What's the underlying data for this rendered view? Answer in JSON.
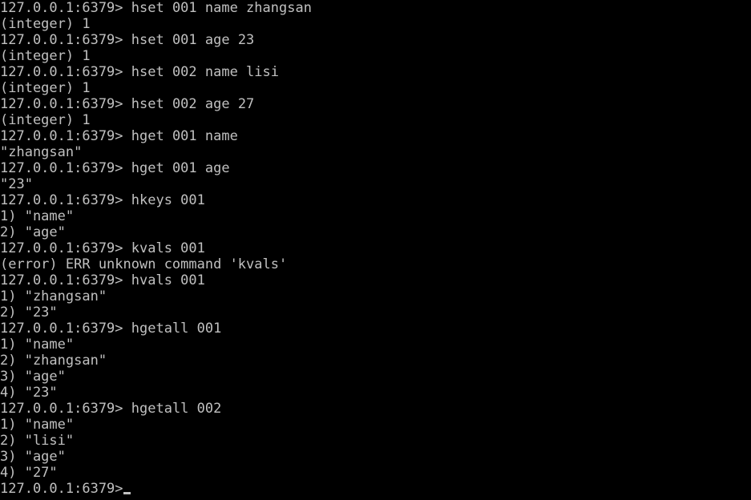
{
  "terminal": {
    "lines": [
      {
        "prompt": "127.0.0.1:6379> ",
        "text": "hset 001 name zhangsan"
      },
      {
        "prompt": "",
        "text": "(integer) 1"
      },
      {
        "prompt": "127.0.0.1:6379> ",
        "text": "hset 001 age 23"
      },
      {
        "prompt": "",
        "text": "(integer) 1"
      },
      {
        "prompt": "127.0.0.1:6379> ",
        "text": "hset 002 name lisi"
      },
      {
        "prompt": "",
        "text": "(integer) 1"
      },
      {
        "prompt": "127.0.0.1:6379> ",
        "text": "hset 002 age 27"
      },
      {
        "prompt": "",
        "text": "(integer) 1"
      },
      {
        "prompt": "127.0.0.1:6379> ",
        "text": "hget 001 name"
      },
      {
        "prompt": "",
        "text": "\"zhangsan\""
      },
      {
        "prompt": "127.0.0.1:6379> ",
        "text": "hget 001 age"
      },
      {
        "prompt": "",
        "text": "\"23\""
      },
      {
        "prompt": "127.0.0.1:6379> ",
        "text": "hkeys 001"
      },
      {
        "prompt": "",
        "text": "1) \"name\""
      },
      {
        "prompt": "",
        "text": "2) \"age\""
      },
      {
        "prompt": "127.0.0.1:6379> ",
        "text": "kvals 001"
      },
      {
        "prompt": "",
        "text": "(error) ERR unknown command 'kvals'"
      },
      {
        "prompt": "127.0.0.1:6379> ",
        "text": "hvals 001"
      },
      {
        "prompt": "",
        "text": "1) \"zhangsan\""
      },
      {
        "prompt": "",
        "text": "2) \"23\""
      },
      {
        "prompt": "127.0.0.1:6379> ",
        "text": "hgetall 001"
      },
      {
        "prompt": "",
        "text": "1) \"name\""
      },
      {
        "prompt": "",
        "text": "2) \"zhangsan\""
      },
      {
        "prompt": "",
        "text": "3) \"age\""
      },
      {
        "prompt": "",
        "text": "4) \"23\""
      },
      {
        "prompt": "127.0.0.1:6379> ",
        "text": "hgetall 002"
      },
      {
        "prompt": "",
        "text": "1) \"name\""
      },
      {
        "prompt": "",
        "text": "2) \"lisi\""
      },
      {
        "prompt": "",
        "text": "3) \"age\""
      },
      {
        "prompt": "",
        "text": "4) \"27\""
      }
    ],
    "current_prompt": "127.0.0.1:6379>",
    "colors": {
      "background": "#000000",
      "foreground": "#c0c0c0"
    }
  }
}
